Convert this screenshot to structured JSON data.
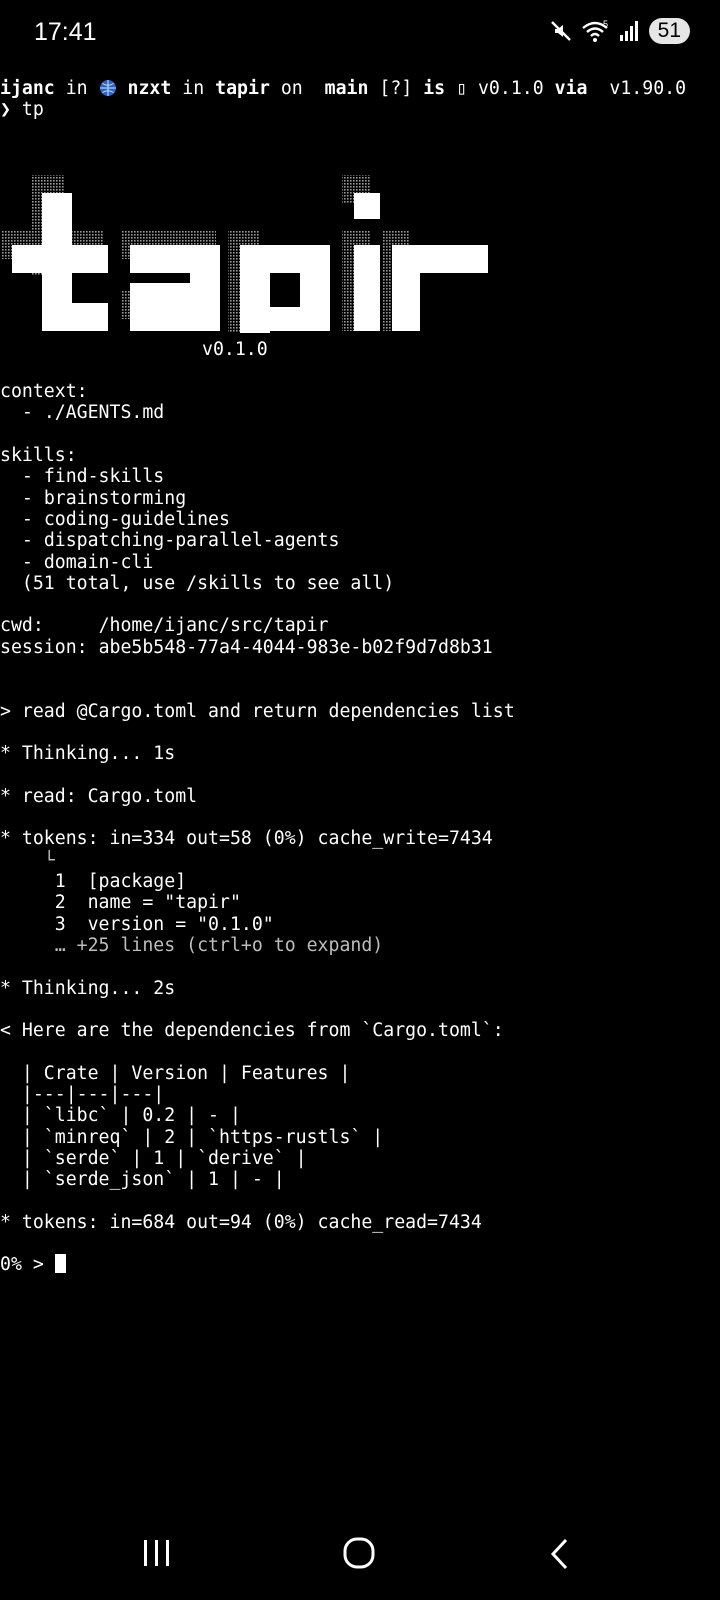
{
  "status_bar": {
    "time": "17:41",
    "battery": "51",
    "icons": [
      "mute-icon",
      "wifi-icon",
      "signal-icon",
      "battery-icon"
    ]
  },
  "prompt": {
    "user": "ijanc",
    "in1": " in ",
    "host": "nzxt",
    "in2": " in ",
    "dir": "tapir",
    "on": " on ",
    "branch": "main",
    "git_status": " [?] ",
    "is": "is",
    "pkg_icon": " ",
    "version": " v0.1.0 ",
    "via": "via",
    "rust_version": "  v1.90.0",
    "arrow": "❯",
    "command": " tp"
  },
  "banner": {
    "logo_text": "tapir",
    "version": "v0.1.0"
  },
  "context": {
    "header": "context:",
    "items": [
      "./AGENTS.md"
    ]
  },
  "skills": {
    "header": "skills:",
    "items": [
      "find-skills",
      "brainstorming",
      "coding-guidelines",
      "dispatching-parallel-agents",
      "domain-cli"
    ],
    "summary": "(51 total, use /skills to see all)"
  },
  "info": {
    "cwd_label": "cwd:",
    "cwd": "/home/ijanc/src/tapir",
    "session_label": "session:",
    "session": "abe5b548-77a4-4044-983e-b02f9d7d8b31"
  },
  "conversation": {
    "user_msg": "> read @Cargo.toml and return dependencies list",
    "thinking1": "* Thinking... 1s",
    "read_call": "* read: Cargo.toml",
    "tokens1": "* tokens: in=334 out=58 (0%) cache_write=7434",
    "tree_corner": "└",
    "file_lines": [
      {
        "num": "1",
        "text": "[package]"
      },
      {
        "num": "2",
        "text": "name = \"tapir\""
      },
      {
        "num": "3",
        "text": "version = \"0.1.0\""
      }
    ],
    "more_lines": "… +25 lines (ctrl+o to expand)",
    "thinking2": "* Thinking... 2s",
    "reply_intro": "< Here are the dependencies from `Cargo.toml`:",
    "table_lines": [
      "| Crate | Version | Features |",
      "|---|---|---|",
      "| `libc` | 0.2 | - |",
      "| `minreq` | 2 | `https-rustls` |",
      "| `serde` | 1 | `derive` |",
      "| `serde_json` | 1 | - |"
    ],
    "tokens2": "* tokens: in=684 out=94 (0%) cache_read=7434"
  },
  "input": {
    "prompt": "0% > "
  },
  "nav": {
    "icons": [
      "recent-apps-icon",
      "home-icon",
      "back-icon"
    ]
  }
}
